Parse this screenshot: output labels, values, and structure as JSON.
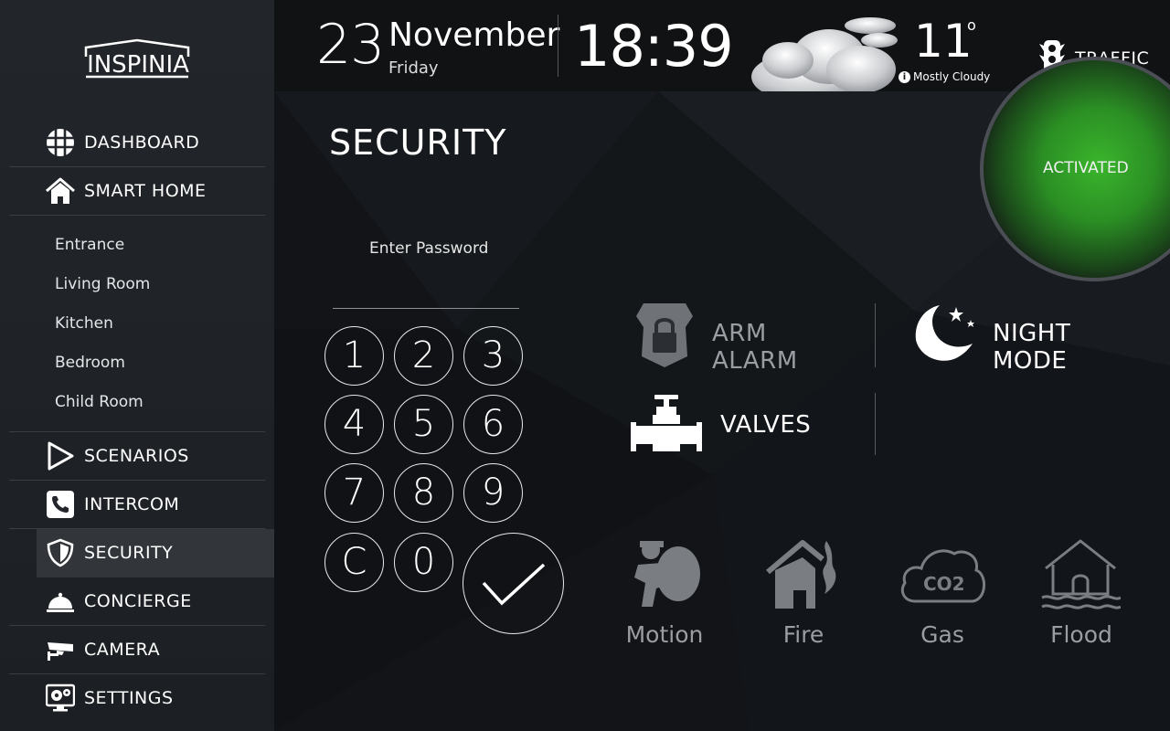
{
  "app": {
    "logo_text": "INSPINIA"
  },
  "sidebar": {
    "items": [
      {
        "label": "DASHBOARD",
        "icon": "dashboard-grid-icon"
      },
      {
        "label": "SMART HOME",
        "icon": "home-icon"
      },
      {
        "label": "SCENARIOS",
        "icon": "play-icon"
      },
      {
        "label": "INTERCOM",
        "icon": "phone-icon"
      },
      {
        "label": "SECURITY",
        "icon": "shield-icon",
        "active": true
      },
      {
        "label": "CONCIERGE",
        "icon": "service-bell-icon"
      },
      {
        "label": "CAMERA",
        "icon": "camera-icon"
      },
      {
        "label": "SETTINGS",
        "icon": "settings-gear-icon"
      }
    ],
    "subitems": [
      "Entrance",
      "Living Room",
      "Kitchen",
      "Bedroom",
      "Child Room"
    ]
  },
  "header": {
    "day": "23",
    "month": "November",
    "weekday": "Friday",
    "time": "18:39",
    "temperature": "11",
    "degree_symbol": "o",
    "weather": "Mostly Cloudy",
    "weather_icon": "cloud-icon",
    "traffic_label": "TRAFFIC"
  },
  "security": {
    "title": "SECURITY",
    "status": "ACTIVATED",
    "status_color": "#3ab52c",
    "password_label": "Enter Password",
    "password_value": "",
    "keys": [
      "1",
      "2",
      "3",
      "4",
      "5",
      "6",
      "7",
      "8",
      "9",
      "C",
      "0"
    ],
    "controls": {
      "arm_alarm": "ARM ALARM",
      "night_mode": "NIGHT MODE",
      "valves": "VALVES"
    },
    "sensors": [
      {
        "label": "Motion",
        "icon": "motion-burglar-icon"
      },
      {
        "label": "Fire",
        "icon": "fire-house-icon"
      },
      {
        "label": "Gas",
        "icon": "co2-cloud-icon"
      },
      {
        "label": "Flood",
        "icon": "flood-house-icon"
      }
    ]
  },
  "colors": {
    "sidebar_bg": "#1f2226",
    "active_item_bg": "#32363b",
    "inactive_control": "#9a9da1"
  }
}
